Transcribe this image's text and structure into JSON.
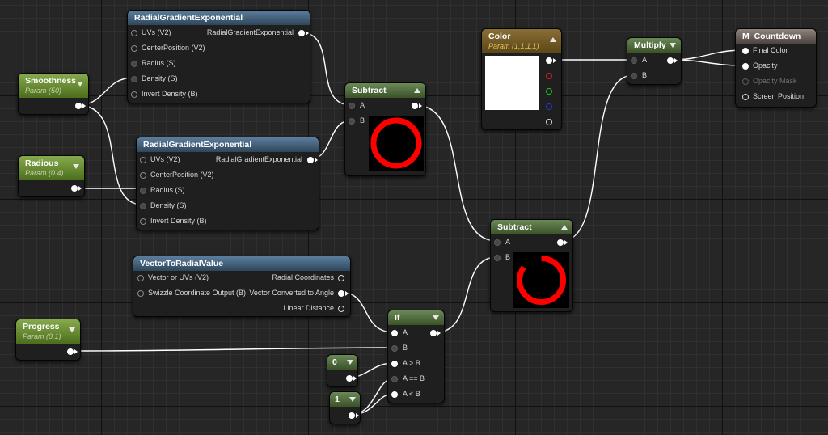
{
  "nodes": {
    "rge_top": {
      "title": "RadialGradientExponential",
      "inputs": [
        "UVs (V2)",
        "CenterPosition (V2)",
        "Radius (S)",
        "Density (S)",
        "Invert Density (B)"
      ],
      "output": "RadialGradientExponential"
    },
    "rge_mid": {
      "title": "RadialGradientExponential",
      "inputs": [
        "UVs (V2)",
        "CenterPosition (V2)",
        "Radius (S)",
        "Density (S)",
        "Invert Density (B)"
      ],
      "output": "RadialGradientExponential"
    },
    "smoothness": {
      "title": "Smoothness",
      "subtitle": "Param (50)"
    },
    "radious": {
      "title": "Radious",
      "subtitle": "Param (0.4)"
    },
    "progress": {
      "title": "Progress",
      "subtitle": "Param (0.1)"
    },
    "subtract1": {
      "title": "Subtract",
      "inputs": [
        "A",
        "B"
      ]
    },
    "subtract2": {
      "title": "Subtract",
      "inputs": [
        "A",
        "B"
      ]
    },
    "color": {
      "title": "Color",
      "subtitle": "Param (1,1,1,1)"
    },
    "multiply": {
      "title": "Multiply",
      "inputs": [
        "A",
        "B"
      ]
    },
    "m_countdown": {
      "title": "M_Countdown",
      "inputs": [
        "Final Color",
        "Opacity",
        "Opacity Mask",
        "Screen Position"
      ]
    },
    "vector_to_radial": {
      "title": "VectorToRadialValue",
      "inputs": [
        "Vector or UVs (V2)",
        "Swizzle Coordinate Output (B)"
      ],
      "outputs": [
        "Radial Coordinates",
        "Vector Converted to Angle",
        "Linear Distance"
      ]
    },
    "if_node": {
      "title": "If",
      "inputs": [
        "A",
        "B",
        "A > B",
        "A == B",
        "A < B"
      ]
    },
    "const0": {
      "title": "0"
    },
    "const1": {
      "title": "1"
    }
  },
  "colors": {
    "wire": "#ffffff",
    "ring": "#ff0000",
    "grid_bg": "#262626",
    "header_blue": "#4a6a88",
    "header_green": "#567445"
  },
  "previews": {
    "subtract1": {
      "shape": "full ring",
      "fill_fraction": 1.0
    },
    "subtract2": {
      "shape": "partial ring",
      "fill_fraction": 0.85
    }
  }
}
